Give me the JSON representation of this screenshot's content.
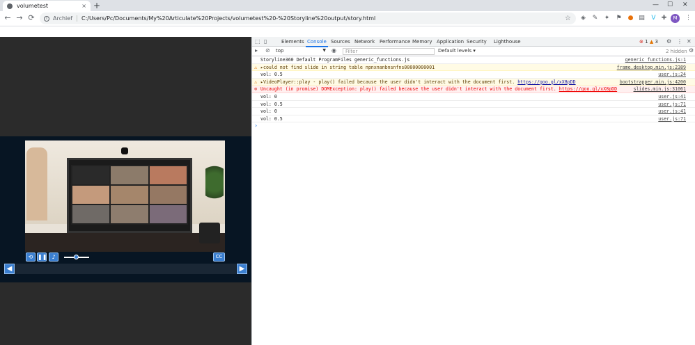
{
  "browser": {
    "tab_title": "volumetest",
    "tab_close": "×",
    "new_tab": "+",
    "window_controls": [
      "—",
      "☐",
      "✕"
    ],
    "nav": [
      "←",
      "→",
      "⟳"
    ],
    "address_label": "Archief",
    "address_url": "C:/Users/Pc/Documents/My%20Articulate%20Projects/volumetest%20-%20Storyline%20output/story.html",
    "bookmark_star": "☆",
    "avatar_initial": "M",
    "accent": "#7e57c2"
  },
  "player": {
    "cc_label": "CC",
    "prev_label": "◀",
    "next_label": "▶",
    "volume_level": 0.5,
    "accent": "#3b7fd0"
  },
  "devtools": {
    "tabs": [
      "Elements",
      "Console",
      "Sources",
      "Network",
      "Performance",
      "Memory",
      "Application",
      "Security",
      "Lighthouse"
    ],
    "active_tab": "Console",
    "error_count": "1",
    "warning_count": "3",
    "context": "top",
    "filter_placeholder": "Filter",
    "levels": "Default levels ▾",
    "hidden": "2 hidden",
    "messages": [
      {
        "type": "log",
        "text": "Storyline360 Default ProgramFiles generic_functions.js",
        "source": "generic_functions.js:1"
      },
      {
        "type": "warn",
        "text": "▸could not find slide in string table npnxnanbnsnfns00000000001",
        "source": "frame.desktop.min.js:2389"
      },
      {
        "type": "log",
        "text": "vol: 0.5",
        "source": "user.js:24"
      },
      {
        "type": "warn",
        "text": "▸VideoPlayer::play - play() failed because the user didn't interact with the document first.",
        "link": "https://goo.gl/xX8pDD",
        "source": "bootstrapper.min.js:4200"
      },
      {
        "type": "error",
        "text": "Uncaught (in promise) DOMException: play() failed because the user didn't interact with the document first.",
        "link": "https://goo.gl/xX8pDD",
        "source": "slides.min.js:31061"
      },
      {
        "type": "log",
        "text": "vol: 0",
        "source": "user.js:41"
      },
      {
        "type": "log",
        "text": "vol: 0.5",
        "source": "user.js:71"
      },
      {
        "type": "log",
        "text": "vol: 0",
        "source": "user.js:41"
      },
      {
        "type": "log",
        "text": "vol: 0.5",
        "source": "user.js:71"
      }
    ],
    "prompt": "›"
  }
}
